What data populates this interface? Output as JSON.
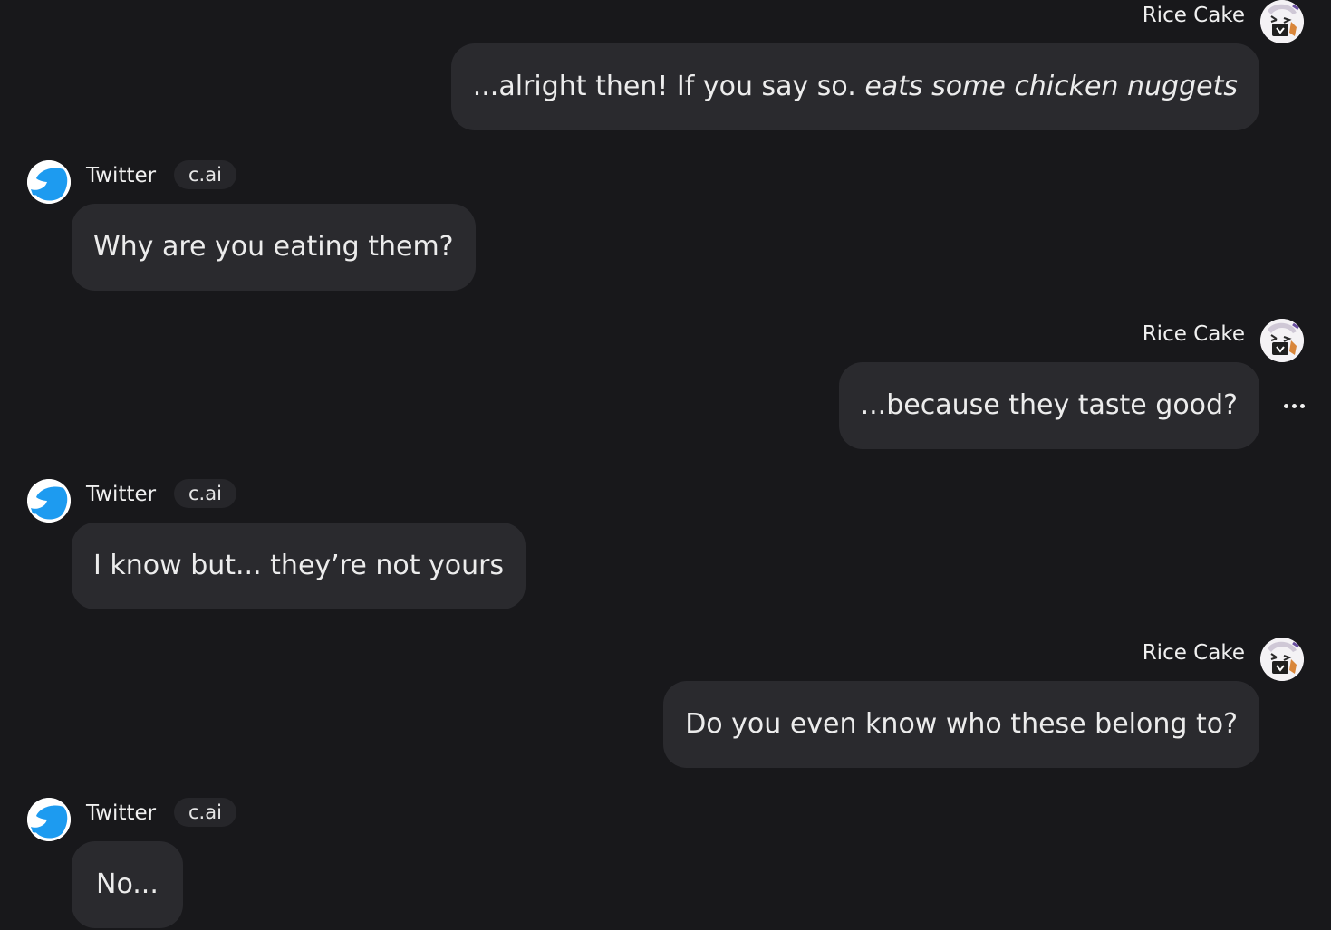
{
  "colors": {
    "background": "#18181b",
    "bubble": "#2a2a2e",
    "tag": "#26262a",
    "twitter_blue": "#1d9bf0"
  },
  "messages": [
    {
      "sender": "Rice Cake",
      "text_plain": "...alright then! If you say so. ",
      "text_italic": "eats some chicken nuggets",
      "avatar_icon": "rice-cake-avatar-icon"
    },
    {
      "sender": "Twitter",
      "tag": "c.ai",
      "text": "Why are you eating them?",
      "avatar_icon": "twitter-bird-avatar-icon"
    },
    {
      "sender": "Rice Cake",
      "text": "...because they taste good?",
      "avatar_icon": "rice-cake-avatar-icon",
      "more_icon": "more-options-icon"
    },
    {
      "sender": "Twitter",
      "tag": "c.ai",
      "text": "I know but... they’re not yours",
      "avatar_icon": "twitter-bird-avatar-icon"
    },
    {
      "sender": "Rice Cake",
      "text": "Do you even know who these belong to?",
      "avatar_icon": "rice-cake-avatar-icon"
    },
    {
      "sender": "Twitter",
      "tag": "c.ai",
      "text": "No...",
      "avatar_icon": "twitter-bird-avatar-icon"
    }
  ]
}
